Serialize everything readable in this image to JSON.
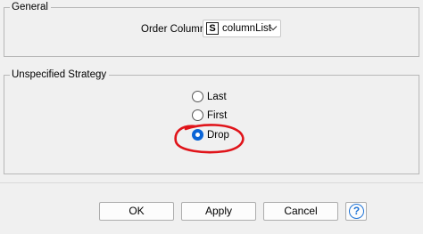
{
  "general": {
    "legend": "General",
    "order_column_label": "Order Column",
    "order_column": {
      "type_badge": "S",
      "value": "columnList",
      "dropdown_icon": "chevron-down-icon"
    }
  },
  "strategy": {
    "legend": "Unspecified Strategy",
    "options": [
      {
        "label": "Last",
        "checked": false
      },
      {
        "label": "First",
        "checked": false
      },
      {
        "label": "Drop",
        "checked": true
      }
    ],
    "annotation": {
      "shape": "hand-drawn-circle",
      "color": "#e0141a"
    }
  },
  "buttons": {
    "ok": "OK",
    "apply": "Apply",
    "cancel": "Cancel",
    "help": "?",
    "help_icon": "help-icon"
  },
  "colors": {
    "accent": "#0a64d6",
    "help": "#1e73d6",
    "annotation": "#e0141a"
  }
}
